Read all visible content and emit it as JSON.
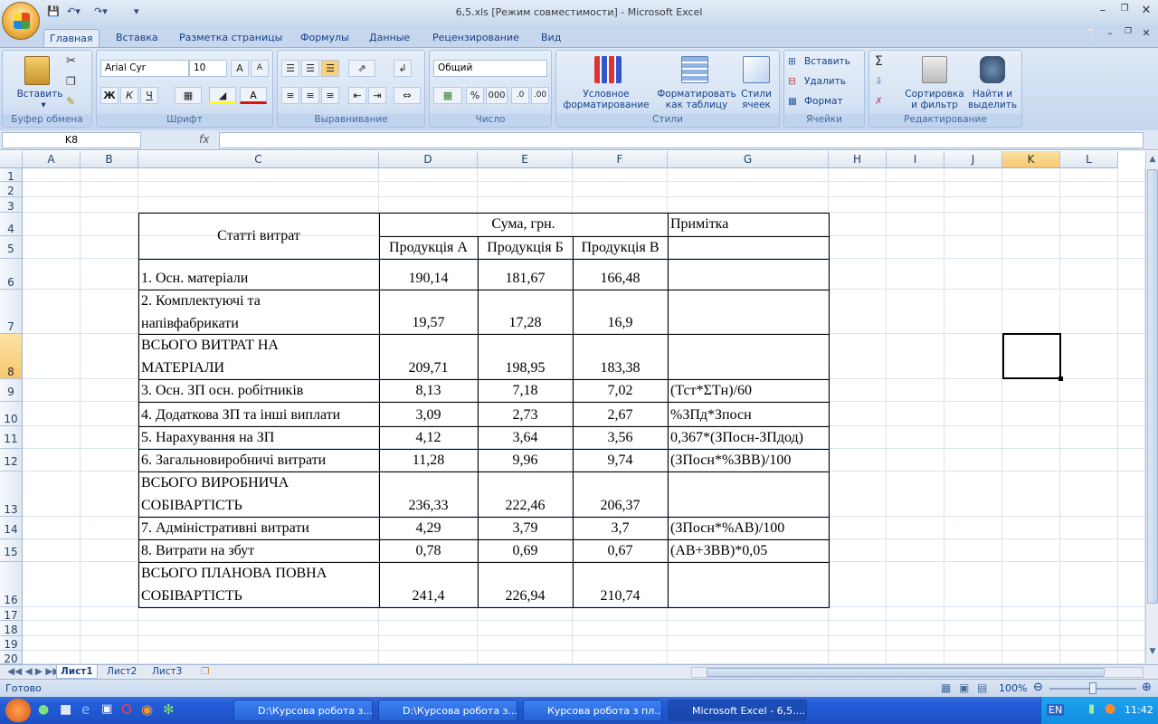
{
  "window": {
    "title": "6,5.xls  [Режим совместимости] - Microsoft Excel"
  },
  "qat": {
    "save": "save-icon",
    "undo": "undo-icon",
    "redo": "redo-icon"
  },
  "ribbon_tabs": [
    "Главная",
    "Вставка",
    "Разметка страницы",
    "Формулы",
    "Данные",
    "Рецензирование",
    "Вид"
  ],
  "groups": {
    "clipboard": {
      "label": "Буфер обмена",
      "paste": "Вставить"
    },
    "font": {
      "label": "Шрифт",
      "family": "Arial Cyr",
      "size": "10",
      "bold": "Ж",
      "italic": "К",
      "underline": "Ч"
    },
    "alignment": {
      "label": "Выравнивание"
    },
    "number": {
      "label": "Число",
      "format": "Общий",
      "percent": "%",
      "thousands": "000"
    },
    "styles": {
      "label": "Стили",
      "cond1": "Условное",
      "cond2": "форматирование",
      "table1": "Форматировать",
      "table2": "как таблицу",
      "cell1": "Стили",
      "cell2": "ячеек"
    },
    "cells": {
      "label": "Ячейки",
      "insert": "Вставить",
      "delete": "Удалить",
      "format": "Формат"
    },
    "editing": {
      "label": "Редактирование",
      "sum": "Σ",
      "sort1": "Сортировка",
      "sort2": "и фильтр",
      "find1": "Найти и",
      "find2": "выделить"
    }
  },
  "formula_bar": {
    "name_box": "K8",
    "fx": "fx",
    "value": ""
  },
  "columns": [
    "A",
    "B",
    "C",
    "D",
    "E",
    "F",
    "G",
    "H",
    "I",
    "J",
    "K",
    "L"
  ],
  "rows": [
    "1",
    "2",
    "3",
    "4",
    "5",
    "6",
    "7",
    "8",
    "9",
    "10",
    "11",
    "12",
    "13",
    "14",
    "15",
    "16",
    "17",
    "18",
    "19",
    "20"
  ],
  "table": {
    "header_item": "Статті витрат",
    "header_sum": "Сума, грн.",
    "header_note": "Примітка",
    "products": [
      "Продукція А",
      "Продукція Б",
      "Продукція В"
    ],
    "rows": [
      {
        "line1": "1. Осн. матеріали",
        "line2": "",
        "a": "190,14",
        "b": "181,67",
        "c": "166,48",
        "note": ""
      },
      {
        "line1": "2. Комплектуючі та",
        "line2": "напівфабрикати",
        "a": "19,57",
        "b": "17,28",
        "c": "16,9",
        "note": ""
      },
      {
        "line1": "ВСЬОГО ВИТРАТ НА",
        "line2": "МАТЕРІАЛИ",
        "a": "209,71",
        "b": "198,95",
        "c": "183,38",
        "note": ""
      },
      {
        "line1": "3. Осн. ЗП осн. робітників",
        "line2": "",
        "a": "8,13",
        "b": "7,18",
        "c": "7,02",
        "note": "(Тст*ΣТн)/60"
      },
      {
        "line1": "4. Додаткова ЗП та інші виплати",
        "line2": "",
        "a": "3,09",
        "b": "2,73",
        "c": "2,67",
        "note": "%ЗПд*Зпосн"
      },
      {
        "line1": "5. Нарахування на ЗП",
        "line2": "",
        "a": "4,12",
        "b": "3,64",
        "c": "3,56",
        "note": "0,367*(ЗПосн-ЗПдод)"
      },
      {
        "line1": "6. Загальновиробничі витрати",
        "line2": "",
        "a": "11,28",
        "b": "9,96",
        "c": "9,74",
        "note": "(ЗПосн*%ЗВВ)/100"
      },
      {
        "line1": "ВСЬОГО ВИРОБНИЧА",
        "line2": "СОБІВАРТІСТЬ",
        "a": "236,33",
        "b": "222,46",
        "c": "206,37",
        "note": ""
      },
      {
        "line1": "7. Адміністративні витрати",
        "line2": "",
        "a": "4,29",
        "b": "3,79",
        "c": "3,7",
        "note": "(ЗПосн*%АВ)/100"
      },
      {
        "line1": "8. Витрати на збут",
        "line2": "",
        "a": "0,78",
        "b": "0,69",
        "c": "0,67",
        "note": "(АВ+ЗВВ)*0,05"
      },
      {
        "line1": "ВСЬОГО ПЛАНОВА ПОВНА",
        "line2": "СОБІВАРТІСТЬ",
        "a": "241,4",
        "b": "226,94",
        "c": "210,74",
        "note": ""
      }
    ]
  },
  "sheets": [
    "Лист1",
    "Лист2",
    "Лист3"
  ],
  "status": {
    "ready": "Готово",
    "zoom": "100%"
  },
  "taskbar": {
    "windows": [
      "D:\\Курсова робота з...",
      "D:\\Курсова робота з...",
      "Курсова робота з пл...",
      "Microsoft Excel - 6,5...."
    ],
    "lang": "EN",
    "clock": "11:42"
  }
}
